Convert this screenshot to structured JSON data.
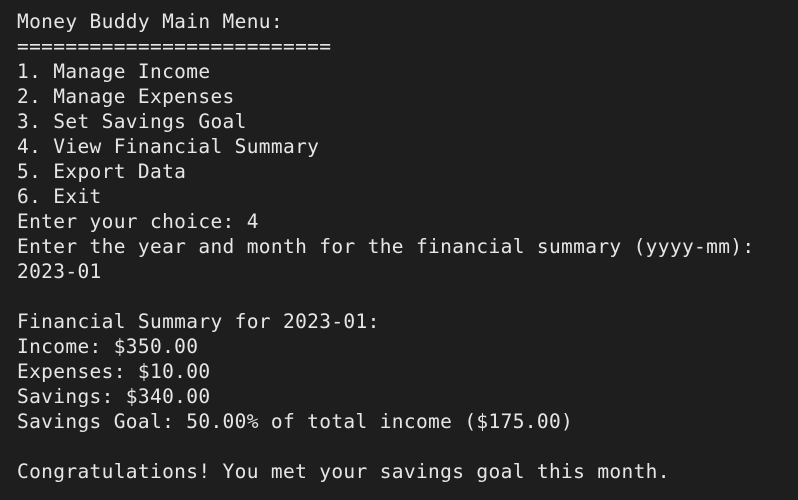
{
  "terminal": {
    "lines": [
      "Money Buddy Main Menu:",
      "==========================",
      "1. Manage Income",
      "2. Manage Expenses",
      "3. Set Savings Goal",
      "4. View Financial Summary",
      "5. Export Data",
      "6. Exit",
      "Enter your choice: 4",
      "Enter the year and month for the financial summary (yyyy-mm):",
      "2023-01",
      "",
      "Financial Summary for 2023-01:",
      "Income: $350.00",
      "Expenses: $10.00",
      "Savings: $340.00",
      "Savings Goal: 50.00% of total income ($175.00)",
      "",
      "Congratulations! You met your savings goal this month."
    ]
  }
}
